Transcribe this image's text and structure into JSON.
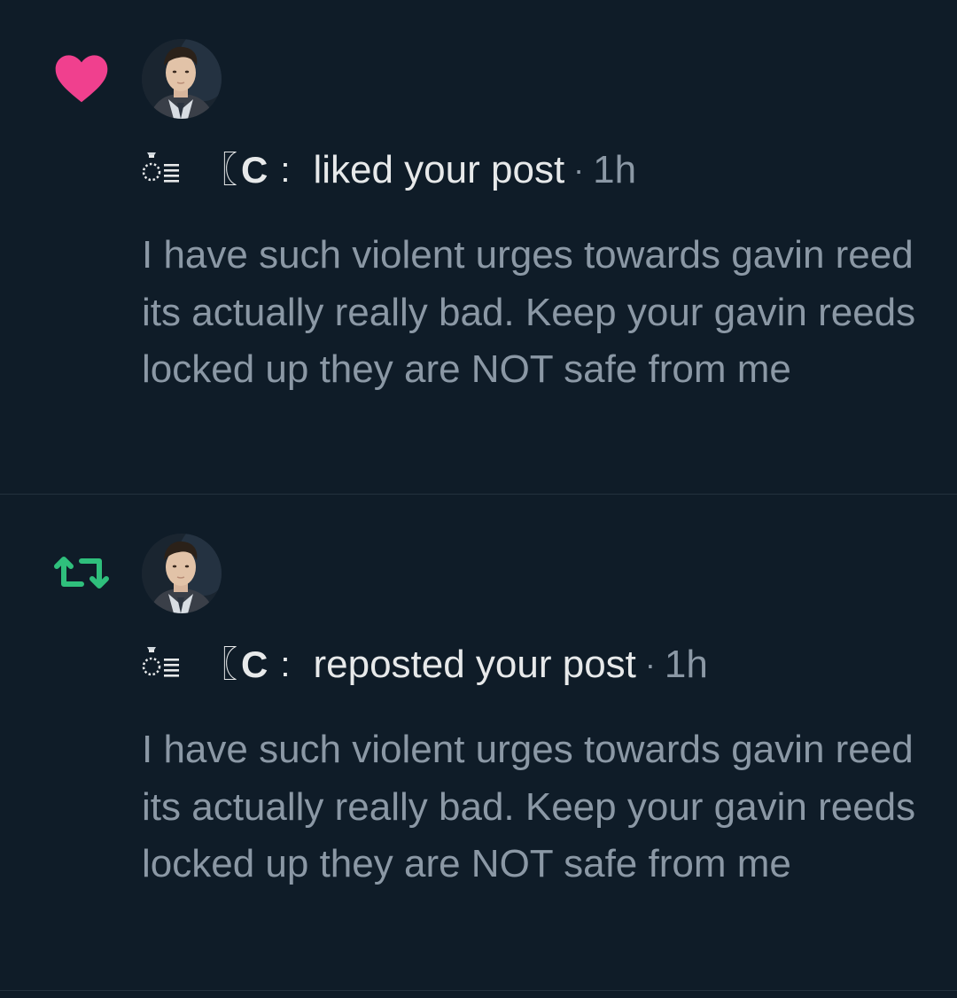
{
  "notifications": [
    {
      "type": "like",
      "icon": "heart-icon",
      "icon_color": "#f91880",
      "user": {
        "name_emoji": "ring-list-emoji",
        "bracket": "〖",
        "letter": "C",
        "colon": ":"
      },
      "action": "liked your post",
      "separator": "·",
      "time": "1h",
      "post_text": "I have such violent urges towards gavin reed its actually really bad. Keep your gavin reeds locked up they are NOT safe from me"
    },
    {
      "type": "repost",
      "icon": "repost-icon",
      "icon_color": "#00ba7c",
      "user": {
        "name_emoji": "ring-list-emoji",
        "bracket": "〖",
        "letter": "C",
        "colon": ":"
      },
      "action": "reposted your post",
      "separator": "·",
      "time": "1h",
      "post_text": "I have such violent urges towards gavin reed its actually really bad. Keep your gavin reeds locked up they are NOT safe from me"
    }
  ],
  "colors": {
    "background": "#0f1c28",
    "primary_text": "#e7e9ea",
    "secondary_text": "#8b98a5",
    "divider": "#23313d"
  }
}
